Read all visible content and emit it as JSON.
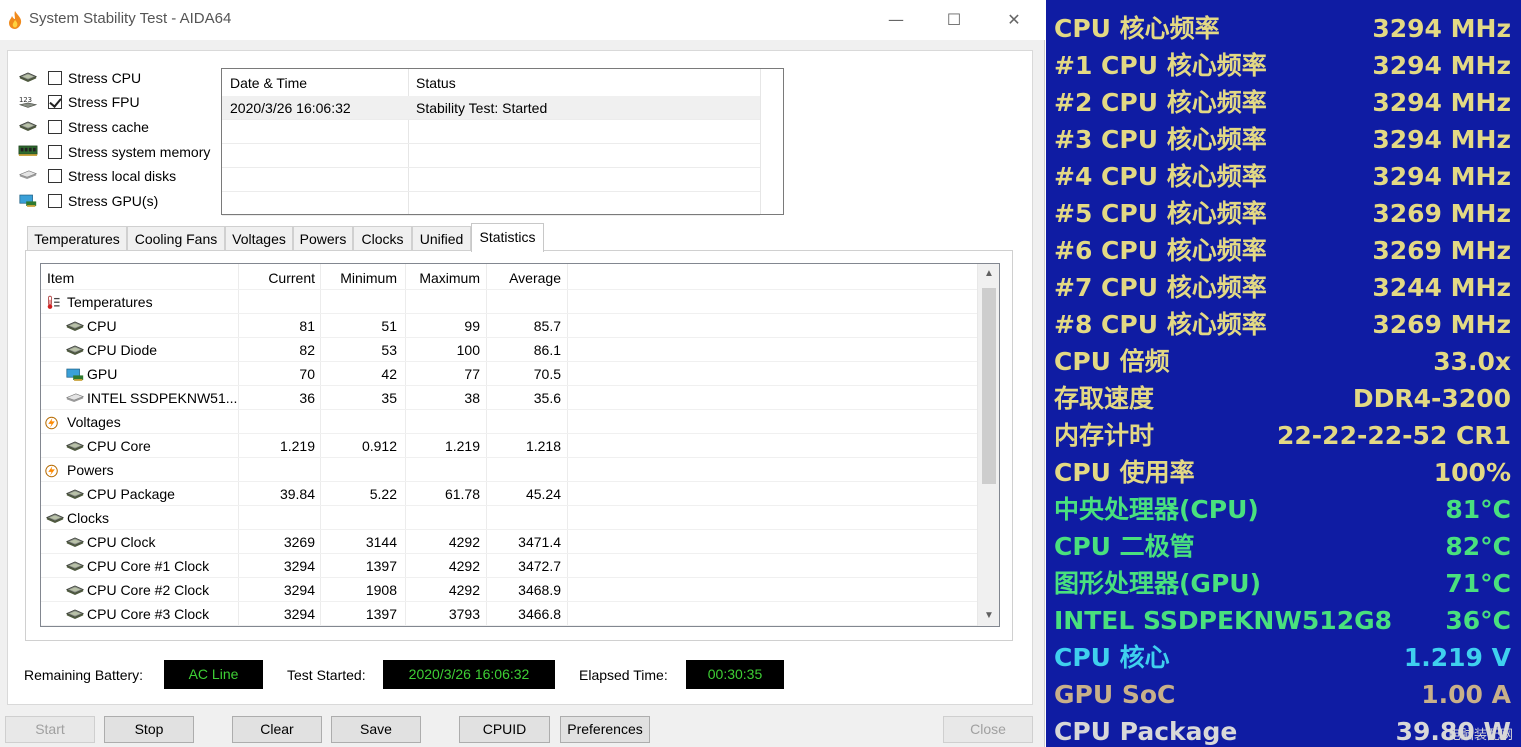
{
  "window": {
    "title": "System Stability Test - AIDA64",
    "minimize": "—",
    "maximize": "☐",
    "close": "✕"
  },
  "stress": [
    {
      "label": "Stress CPU",
      "checked": false,
      "icon": "cpu-chip-icon"
    },
    {
      "label": "Stress FPU",
      "checked": true,
      "icon": "fpu-123-icon"
    },
    {
      "label": "Stress cache",
      "checked": false,
      "icon": "cache-chip-icon"
    },
    {
      "label": "Stress system memory",
      "checked": false,
      "icon": "memory-module-icon"
    },
    {
      "label": "Stress local disks",
      "checked": false,
      "icon": "disk-drive-icon"
    },
    {
      "label": "Stress GPU(s)",
      "checked": false,
      "icon": "gpu-card-icon"
    }
  ],
  "log": {
    "headers": [
      "Date & Time",
      "Status"
    ],
    "rows": [
      [
        "2020/3/26 16:06:32",
        "Stability Test: Started"
      ]
    ]
  },
  "tabs": [
    "Temperatures",
    "Cooling Fans",
    "Voltages",
    "Powers",
    "Clocks",
    "Unified",
    "Statistics"
  ],
  "active_tab": "Statistics",
  "stats": {
    "headers": [
      "Item",
      "Current",
      "Minimum",
      "Maximum",
      "Average"
    ],
    "rows": [
      {
        "type": "group",
        "icon": "thermometer-icon",
        "item": "Temperatures"
      },
      {
        "type": "item",
        "icon": "cpu-chip-icon",
        "item": "CPU",
        "current": "81",
        "min": "51",
        "max": "99",
        "avg": "85.7"
      },
      {
        "type": "item",
        "icon": "cpu-chip-icon",
        "item": "CPU Diode",
        "current": "82",
        "min": "53",
        "max": "100",
        "avg": "86.1"
      },
      {
        "type": "item",
        "icon": "gpu-card-icon",
        "item": "GPU",
        "current": "70",
        "min": "42",
        "max": "77",
        "avg": "70.5"
      },
      {
        "type": "item",
        "icon": "disk-drive-icon",
        "item": "INTEL SSDPEKNW51...",
        "current": "36",
        "min": "35",
        "max": "38",
        "avg": "35.6"
      },
      {
        "type": "group",
        "icon": "lightning-icon",
        "item": "Voltages"
      },
      {
        "type": "item",
        "icon": "cpu-chip-icon",
        "item": "CPU Core",
        "current": "1.219",
        "min": "0.912",
        "max": "1.219",
        "avg": "1.218"
      },
      {
        "type": "group",
        "icon": "lightning-icon",
        "item": "Powers"
      },
      {
        "type": "item",
        "icon": "cpu-chip-icon",
        "item": "CPU Package",
        "current": "39.84",
        "min": "5.22",
        "max": "61.78",
        "avg": "45.24"
      },
      {
        "type": "group",
        "icon": "clock-chip-icon",
        "item": "Clocks"
      },
      {
        "type": "item",
        "icon": "cpu-chip-icon",
        "item": "CPU Clock",
        "current": "3269",
        "min": "3144",
        "max": "4292",
        "avg": "3471.4"
      },
      {
        "type": "item",
        "icon": "cpu-chip-icon",
        "item": "CPU Core #1 Clock",
        "current": "3294",
        "min": "1397",
        "max": "4292",
        "avg": "3472.7"
      },
      {
        "type": "item",
        "icon": "cpu-chip-icon",
        "item": "CPU Core #2 Clock",
        "current": "3294",
        "min": "1908",
        "max": "4292",
        "avg": "3468.9"
      },
      {
        "type": "item",
        "icon": "cpu-chip-icon",
        "item": "CPU Core #3 Clock",
        "current": "3294",
        "min": "1397",
        "max": "3793",
        "avg": "3466.8"
      }
    ]
  },
  "status": {
    "battery_label": "Remaining Battery:",
    "battery_value": "AC Line",
    "started_label": "Test Started:",
    "started_value": "2020/3/26 16:06:32",
    "elapsed_label": "Elapsed Time:",
    "elapsed_value": "00:30:35"
  },
  "buttons": {
    "start": "Start",
    "stop": "Stop",
    "clear": "Clear",
    "save": "Save",
    "cpuid": "CPUID",
    "preferences": "Preferences",
    "close": "Close"
  },
  "osd": {
    "rows": [
      {
        "label": "CPU 核心频率",
        "value": "3294 MHz",
        "color": "#e3d984"
      },
      {
        "label": "#1 CPU 核心频率",
        "value": "3294 MHz",
        "color": "#e3d984"
      },
      {
        "label": "#2 CPU 核心频率",
        "value": "3294 MHz",
        "color": "#e3d984"
      },
      {
        "label": "#3 CPU 核心频率",
        "value": "3294 MHz",
        "color": "#e3d984"
      },
      {
        "label": "#4 CPU 核心频率",
        "value": "3294 MHz",
        "color": "#e3d984"
      },
      {
        "label": "#5 CPU 核心频率",
        "value": "3269 MHz",
        "color": "#e3d984"
      },
      {
        "label": "#6 CPU 核心频率",
        "value": "3269 MHz",
        "color": "#e3d984"
      },
      {
        "label": "#7 CPU 核心频率",
        "value": "3244 MHz",
        "color": "#e3d984"
      },
      {
        "label": "#8 CPU 核心频率",
        "value": "3269 MHz",
        "color": "#e3d984"
      },
      {
        "label": "CPU 倍频",
        "value": "33.0x",
        "color": "#e3d984"
      },
      {
        "label": "存取速度",
        "value": "DDR4-3200",
        "color": "#e3d984"
      },
      {
        "label": "内存计时",
        "value": "22-22-22-52 CR1",
        "color": "#e3d984"
      },
      {
        "label": "CPU 使用率",
        "value": "100%",
        "color": "#e3d984"
      },
      {
        "label": "中央处理器(CPU)",
        "value": "81°C",
        "color": "#49e07e"
      },
      {
        "label": "CPU 二极管",
        "value": "82°C",
        "color": "#49e07e"
      },
      {
        "label": "图形处理器(GPU)",
        "value": "71°C",
        "color": "#49e07e"
      },
      {
        "label": "INTEL SSDPEKNW512G8",
        "value": "36°C",
        "color": "#49e07e"
      },
      {
        "label": "CPU 核心",
        "value": "1.219 V",
        "color": "#3fd0ee"
      },
      {
        "label": "GPU SoC",
        "value": "1.00 A",
        "color": "#c8b08a"
      },
      {
        "label": "CPU Package",
        "value": "39.80 W",
        "color": "#d8d8d8"
      }
    ],
    "watermark": "电脑装配网"
  },
  "colors": {
    "osd_background": "#0f1ca3",
    "status_box_background": "#000000",
    "status_box_text": "#3ecf35"
  }
}
